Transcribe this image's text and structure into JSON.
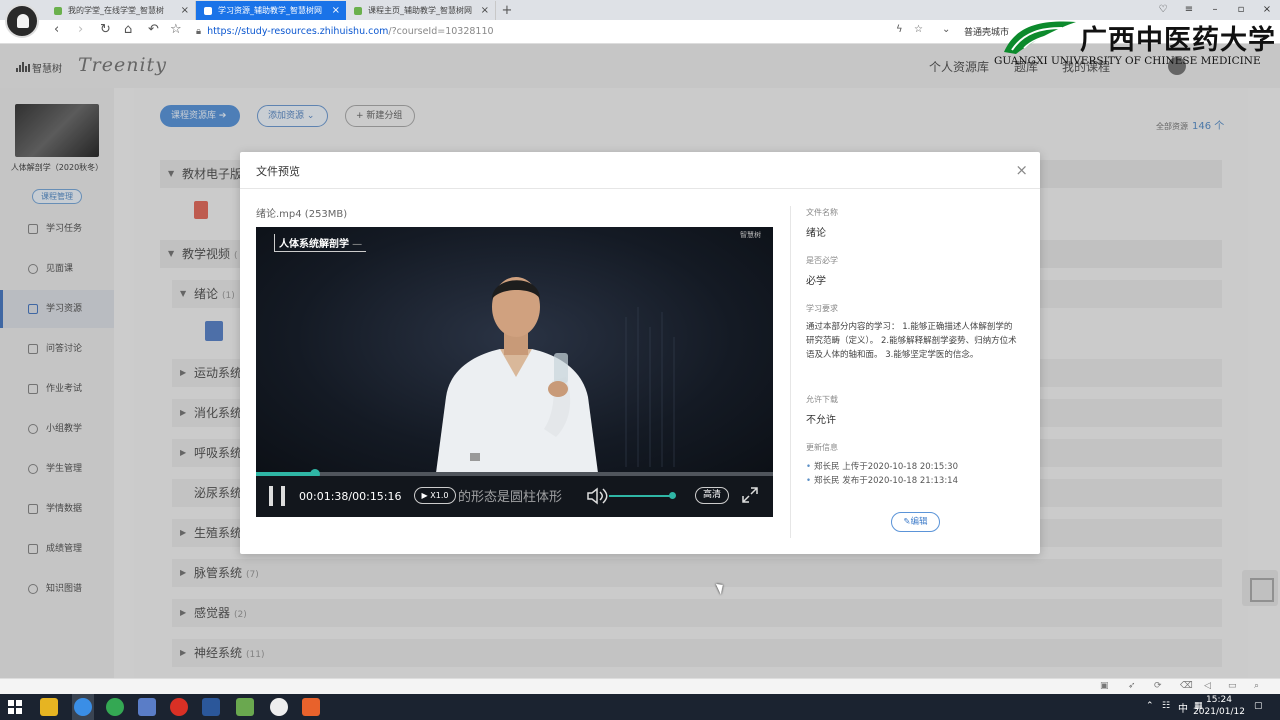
{
  "browser": {
    "tabs": [
      {
        "label": "我的学堂_在线学堂_智慧树",
        "active": false
      },
      {
        "label": "学习资源_辅助教学_智慧树网",
        "active": true
      },
      {
        "label": "课程主页_辅助教学_智慧树网",
        "active": false
      }
    ],
    "url_main": "https://study-resources.zhihuishu.com",
    "url_rest": "/?courseId=10328110",
    "extension_label": "普通壳城市"
  },
  "watermark": {
    "cn": "广西中医药大学",
    "en": "GUANGXI UNIVERSITY OF CHINESE MEDICINE"
  },
  "header": {
    "brand_zh": "智慧树",
    "brand_en": "Treenity",
    "links": [
      "个人资源库",
      "题库",
      "我的课程"
    ]
  },
  "sidebar": {
    "course_name": "人体解剖学（2020秋冬）",
    "course_manage": "课程管理",
    "items": [
      {
        "label": "学习任务",
        "active": false
      },
      {
        "label": "见面课",
        "active": false
      },
      {
        "label": "学习资源",
        "active": true
      },
      {
        "label": "问答讨论",
        "active": false
      },
      {
        "label": "作业考试",
        "active": false
      },
      {
        "label": "小组教学",
        "active": false
      },
      {
        "label": "学生管理",
        "active": false
      },
      {
        "label": "学情数据",
        "active": false
      },
      {
        "label": "成绩管理",
        "active": false
      },
      {
        "label": "知识图谱",
        "active": false
      }
    ]
  },
  "main": {
    "btn_library": "课程资源库",
    "btn_add": "添加资源",
    "btn_new_group": "+ 新建分组",
    "total_label": "全部资源",
    "total_count": "146 个",
    "groups": [
      {
        "label": "教材电子版",
        "count": ""
      },
      {
        "label": "教学视频",
        "count": "("
      },
      {
        "label": "绪论",
        "count": "(1)"
      },
      {
        "label": "运动系统",
        "count": ""
      },
      {
        "label": "消化系统",
        "count": ""
      },
      {
        "label": "呼吸系统",
        "count": ""
      },
      {
        "label": "泌尿系统",
        "count": ""
      },
      {
        "label": "生殖系统",
        "count": ""
      },
      {
        "label": "脉管系统",
        "count": "(7)"
      },
      {
        "label": "感觉器",
        "count": "(2)"
      },
      {
        "label": "神经系统",
        "count": "(11)"
      }
    ]
  },
  "modal": {
    "title": "文件预览",
    "file_title": "绪论.mp4 (253MB)",
    "player": {
      "overlay_title": "人体系统解剖学",
      "overlay_brand": "智慧树",
      "time": "00:01:38/00:15:16",
      "progress": 0.115,
      "speed": "X1.0",
      "subtitle": "的形态是圆柱体形",
      "volume": 0.95,
      "quality": "高清"
    },
    "meta": {
      "name_label": "文件名称",
      "name_value": "绪论",
      "required_label": "是否必学",
      "required_value": "必学",
      "req_label": "学习要求",
      "req_value": "通过本部分内容的学习： 1.能够正确描述人体解剖学的研究范畴（定义）。 2.能够解释解剖学姿势、归纳方位术语及人体的轴和面。 3.能够坚定学医的信念。",
      "download_label": "允许下载",
      "download_value": "不允许",
      "update_label": "更新信息",
      "log1": "郑长民 上传于2020-10-18 20:15:30",
      "log2": "郑长民 发布于2020-10-18 21:13:14",
      "edit_label": "编辑"
    }
  },
  "taskbar": {
    "time": "15:24",
    "date": "2021/01/12",
    "ime": "中"
  }
}
